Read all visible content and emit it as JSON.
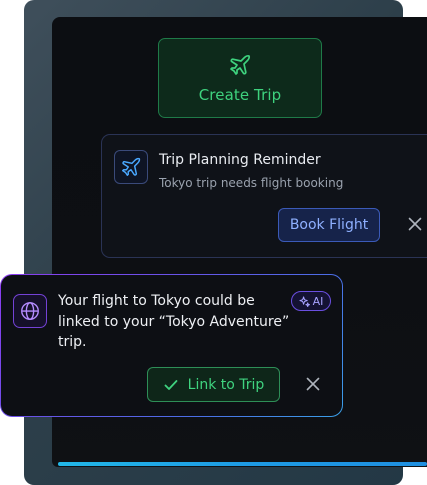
{
  "create_trip": {
    "label": "Create Trip",
    "icon": "airplane-icon",
    "accent": "#3ed27e"
  },
  "reminder": {
    "title": "Trip Planning Reminder",
    "subtitle": "Tokyo trip needs flight booking",
    "icon": "airplane-icon",
    "action_label": "Book Flight",
    "dismiss_icon": "close-icon"
  },
  "suggestion": {
    "message": "Your flight to Tokyo could be linked to your “Tokyo Adventure” trip.",
    "icon": "globe-icon",
    "badge_label": "AI",
    "badge_icon": "sparkles-icon",
    "action_label": "Link to Trip",
    "action_icon": "checkmark-icon",
    "dismiss_icon": "close-icon"
  },
  "colors": {
    "green_accent": "#3ed27e",
    "blue_accent": "#8fb0ff",
    "purple_accent": "#8c3cf0"
  }
}
